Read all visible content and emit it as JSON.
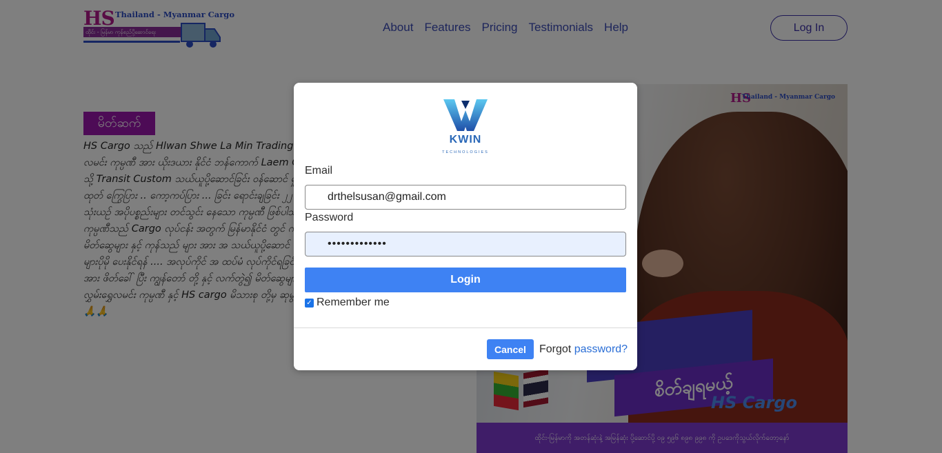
{
  "header": {
    "logo_hs": "HS",
    "logo_subtitle": "Thailand - Myanmar Cargo",
    "logo_tagline": "ထိုင်း - မြန်မာ ကုန်စည်ပို့ဆောင်ရေး",
    "nav": [
      "About",
      "Features",
      "Pricing",
      "Testimonials",
      "Help"
    ],
    "login_label": "Log In"
  },
  "about": {
    "tag": "မိတ်ဆက်",
    "text": "HS Cargo သည် Hlwan Shwe La Min Trading ၏ လုပ်ငန်းခွဲ တခုဖြစ်ပါသည် ... လွှမ်းရွှေလမင်း ကုမ္ပဏီ အား ယိုးဒယား နိုင်ငံ ဘန်ကောက် Laem Chabang မှ ပစ္စည်း များ အား မြန်မာပြည် သို့ Transit Custom သယ်ယူပို့ဆောင်ခြင်း ဝန်ဆောင် မှု ပေးနေသော ကုမ္ပဏီ ... နိုင် ယိုးဒယား နိုင်ငံထုတ် ကြွေပြား .. ကော့ကပ်ပြား ... ခြင်း ရောင်းချခြင်း ၂၂ ဘီး တွဲကားများဖြင့် မြန်မာ နိုင်ငံ မှ လုပ်ငန်းသုံးယဉ် အပိုပစ္စည်းများ တင်သွင်း နေသော ကုမ္ပဏီ ဖြစ်ပါသည် . HS cargo လုပ်ငန်း ခြင်းသည် ကုမ္ပဏီသည် Cargo လုပ်ငန်း အတွက် မြန်မာနိုင်ငံ တွင် ကုန်ကား များ အခြေခံ အဆောက် ကြောင့် မိတ်ဆွေများ နှင့် ကုန်သည် များ အား အ သယ်ယူပို့ဆောင် ရောင်းချ နိုင်စေရန် - ယိုးဒယား အလုပ်ကိုင် များပိုမို ပေးနိုင်ရန် .... အလုပ်ကိုင် အ ထပ်မံ လုပ်ကိုင်ရခြင်းဖြစ်ပါသည် ... မိတ်ဟောင်း မိတ်သစ်များအား ဖိတ်ခေါ် ပြီး ကျွန်တော် တို့ နှင့် လက်တွဲ၍ မိတ်ဆွေများ အကျိုးမြတ် ဖြစ်ထွန်းကြပါစေကြောင်း ..... လွှမ်းရွှေလမင်း ကုမ္ပဏီ နှင့် HS cargo မိသားစု တို့မှ ဆုမွန်ကောင်း တောင်းအပ်ပါသည် ခင်ဗျာ ...... 🙏🙏"
  },
  "hero": {
    "logo_hs": "HS",
    "logo_subtitle": "Thailand - Myanmar Cargo",
    "banner_text": "ဘိကျ",
    "banner_sub": "စိတ်ချရမယ့်",
    "cargo_text": "HS Cargo",
    "footer_text": "ထိုင်း-မြန်မာကို အတန်ဆုံးနဲ့ အမြန်ဆုံး ပို့ဆောင်ပို့ ၀၉ ၅၉၆ ၈၉၈ ၉၉၈ ကို ဥပဒေကိုသွယ်လိုက်တော့နော်"
  },
  "modal": {
    "brand_name": "KWIN",
    "brand_tagline": "TECHNOLOGIES",
    "email_label": "Email",
    "email_value": "drthelsusan@gmail.com",
    "password_label": "Password",
    "password_value": "•••••••••••••",
    "login_button": "Login",
    "remember_label": "Remember me",
    "remember_checked": true,
    "cancel_button": "Cancel",
    "forgot_prefix": "Forgot ",
    "forgot_link": "password?"
  },
  "colors": {
    "primary_button": "#3e82f3",
    "nav_text": "#3b4bb6",
    "about_tag": "#9b17ad",
    "link": "#2a6ed6"
  }
}
